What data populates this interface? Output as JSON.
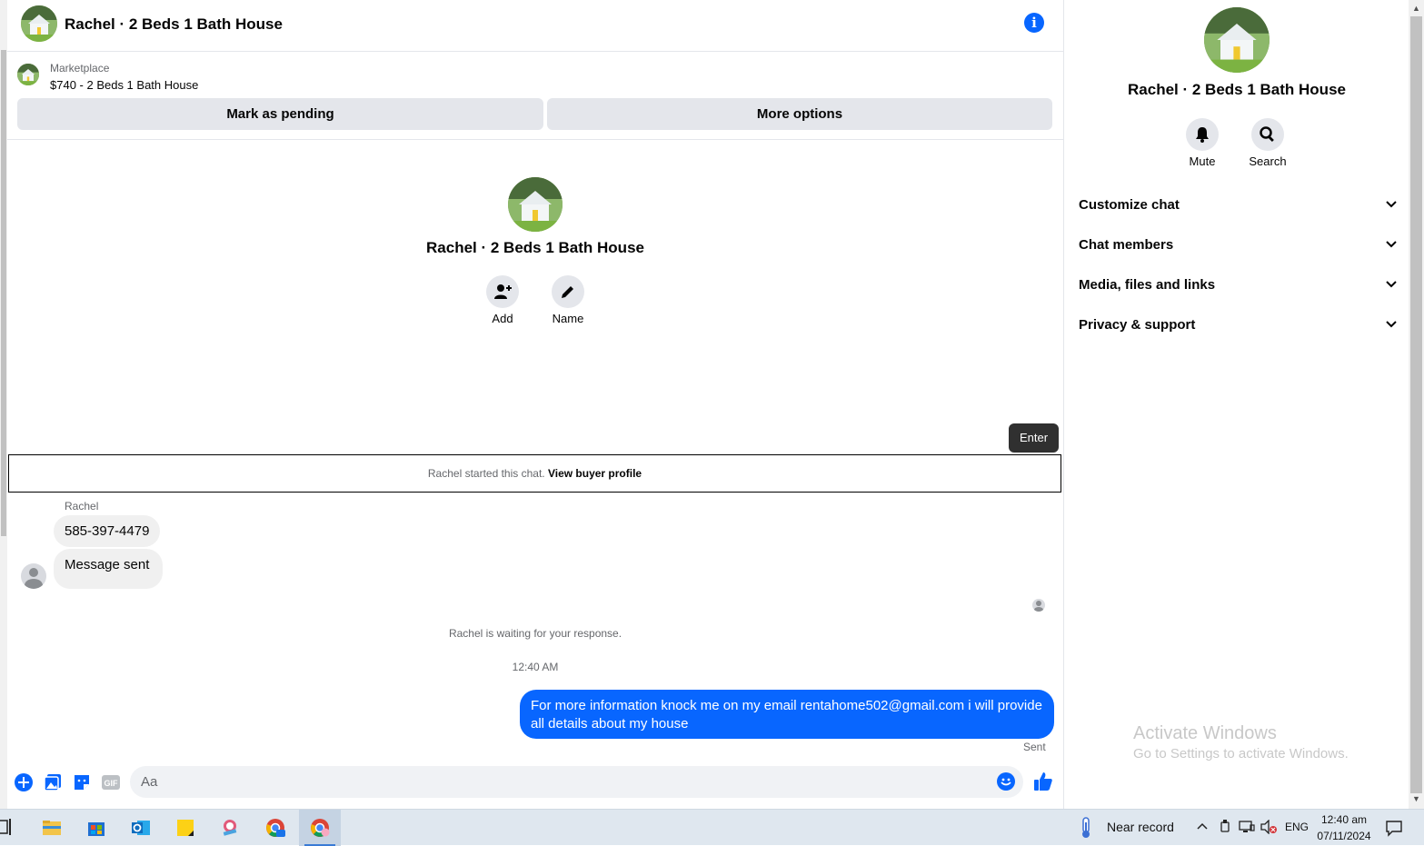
{
  "chat": {
    "title": "Rachel · 2 Beds 1 Bath House",
    "listing": {
      "source": "Marketplace",
      "price_title": "$740 - 2 Beds 1 Bath House"
    },
    "buttons": {
      "mark_pending": "Mark as pending",
      "more_options": "More options"
    },
    "profile": {
      "name": "Rachel · 2 Beds 1 Bath House",
      "actions": [
        {
          "label": "Add",
          "icon": "add-person-icon"
        },
        {
          "label": "Name",
          "icon": "pencil-icon"
        }
      ]
    },
    "tooltip": "Enter",
    "started": {
      "text": "Rachel started this chat.",
      "link": "View buyer profile"
    },
    "sender": "Rachel",
    "incoming": [
      "585-397-4479",
      "Message sent"
    ],
    "waiting_text": "Rachel is waiting for your response.",
    "timestamp": "12:40 AM",
    "outgoing": "For more information knock me on my email rentahome502@gmail.com i will provide all details about my house",
    "status": "Sent",
    "composer": {
      "placeholder": "Aa",
      "icons": [
        "plus-icon",
        "photo-icon",
        "sticker-icon",
        "gif-icon",
        "emoji-icon",
        "like-icon"
      ],
      "gif_label": "GIF"
    }
  },
  "sidebar": {
    "name": "Rachel · 2 Beds 1 Bath House",
    "actions": [
      {
        "label": "Mute",
        "icon": "bell-icon"
      },
      {
        "label": "Search",
        "icon": "search-icon"
      }
    ],
    "sections": [
      {
        "label": "Customize chat"
      },
      {
        "label": "Chat members"
      },
      {
        "label": "Media, files and links"
      },
      {
        "label": "Privacy & support"
      }
    ]
  },
  "watermark": {
    "line1": "Activate Windows",
    "line2": "Go to Settings to activate Windows."
  },
  "taskbar": {
    "weather": "Near record",
    "language": "ENG",
    "time": "12:40 am",
    "date": "07/11/2024"
  },
  "colors": {
    "accent": "#0866ff",
    "bubble_in": "#f0f0f0",
    "button_bg": "#e4e6eb"
  }
}
